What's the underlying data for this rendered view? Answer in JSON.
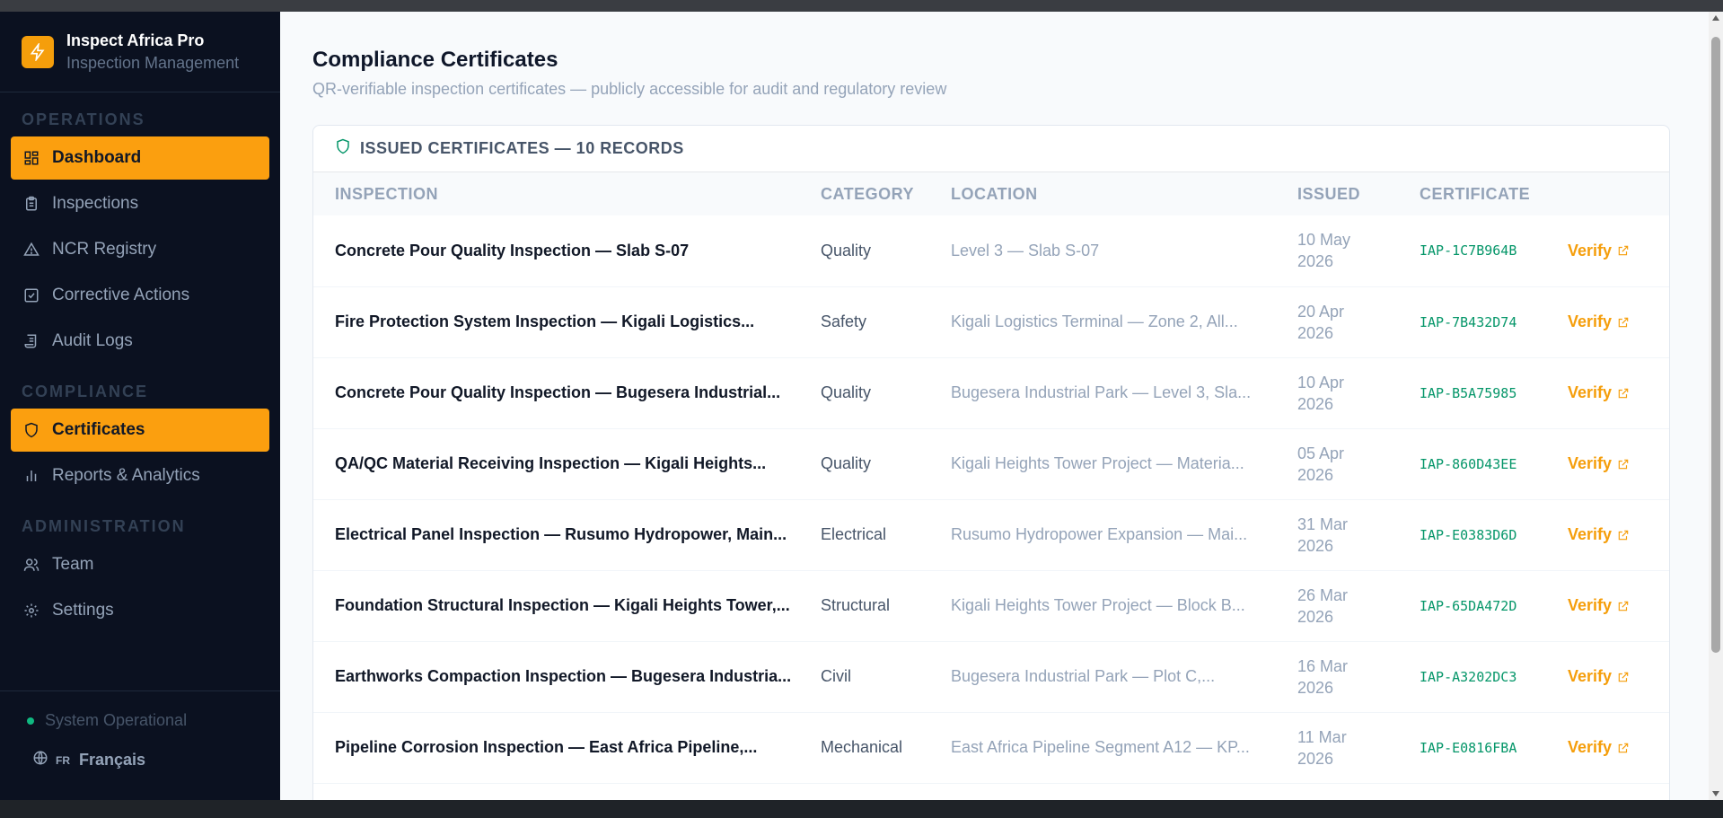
{
  "brand": {
    "title": "Inspect Africa Pro",
    "subtitle": "Inspection Management"
  },
  "sidebar": {
    "sections": [
      {
        "label": "OPERATIONS",
        "items": [
          {
            "label": "Dashboard",
            "icon": "grid-icon",
            "active": true
          },
          {
            "label": "Inspections",
            "icon": "clipboard-icon"
          },
          {
            "label": "NCR Registry",
            "icon": "warning-icon"
          },
          {
            "label": "Corrective Actions",
            "icon": "check-square-icon"
          },
          {
            "label": "Audit Logs",
            "icon": "scroll-icon"
          }
        ]
      },
      {
        "label": "COMPLIANCE",
        "items": [
          {
            "label": "Certificates",
            "icon": "shield-icon",
            "active": true
          },
          {
            "label": "Reports & Analytics",
            "icon": "bar-chart-icon"
          }
        ]
      },
      {
        "label": "ADMINISTRATION",
        "items": [
          {
            "label": "Team",
            "icon": "users-icon"
          },
          {
            "label": "Settings",
            "icon": "gear-icon"
          }
        ]
      }
    ],
    "status": "System Operational",
    "language": {
      "code": "FR",
      "label": "Français"
    }
  },
  "page": {
    "title": "Compliance Certificates",
    "subtitle": "QR-verifiable inspection certificates — publicly accessible for audit and regulatory review"
  },
  "card": {
    "heading": "ISSUED CERTIFICATES — 10 RECORDS",
    "columns": [
      "INSPECTION",
      "CATEGORY",
      "LOCATION",
      "ISSUED",
      "CERTIFICATE"
    ],
    "verify_label": "Verify",
    "rows": [
      {
        "inspection": "Concrete Pour Quality Inspection — Slab S-07",
        "category": "Quality",
        "location": "Level 3 — Slab S-07",
        "issued": "10 May 2026",
        "certificate": "IAP-1C7B964B"
      },
      {
        "inspection": "Fire Protection System Inspection — Kigali Logistics...",
        "category": "Safety",
        "location": "Kigali Logistics Terminal — Zone 2, All...",
        "issued": "20 Apr 2026",
        "certificate": "IAP-7B432D74"
      },
      {
        "inspection": "Concrete Pour Quality Inspection — Bugesera Industrial...",
        "category": "Quality",
        "location": "Bugesera Industrial Park — Level 3, Sla...",
        "issued": "10 Apr 2026",
        "certificate": "IAP-B5A75985"
      },
      {
        "inspection": "QA/QC Material Receiving Inspection — Kigali Heights...",
        "category": "Quality",
        "location": "Kigali Heights Tower Project — Materia...",
        "issued": "05 Apr 2026",
        "certificate": "IAP-860D43EE"
      },
      {
        "inspection": "Electrical Panel Inspection — Rusumo Hydropower, Main...",
        "category": "Electrical",
        "location": "Rusumo Hydropower Expansion — Mai...",
        "issued": "31 Mar 2026",
        "certificate": "IAP-E0383D6D"
      },
      {
        "inspection": "Foundation Structural Inspection — Kigali Heights Tower,...",
        "category": "Structural",
        "location": "Kigali Heights Tower Project — Block B...",
        "issued": "26 Mar 2026",
        "certificate": "IAP-65DA472D"
      },
      {
        "inspection": "Earthworks Compaction Inspection — Bugesera Industria...",
        "category": "Civil",
        "location": "Bugesera Industrial Park — Plot C,...",
        "issued": "16 Mar 2026",
        "certificate": "IAP-A3202DC3"
      },
      {
        "inspection": "Pipeline Corrosion Inspection — East Africa Pipeline,...",
        "category": "Mechanical",
        "location": "East Africa Pipeline Segment A12 — KP...",
        "issued": "11 Mar 2026",
        "certificate": "IAP-E0816FBA"
      }
    ]
  },
  "colors": {
    "accent": "#fb9f0f",
    "sidebar_bg": "#0b1120",
    "cert_code": "#059669",
    "status_dot": "#10b981"
  }
}
